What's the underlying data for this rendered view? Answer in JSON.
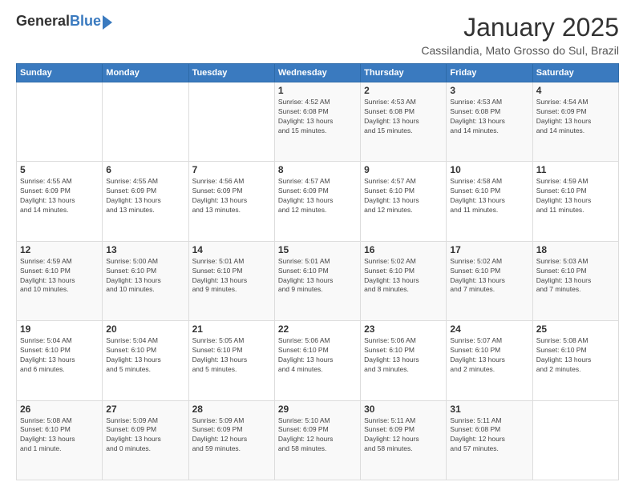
{
  "logo": {
    "general": "General",
    "blue": "Blue"
  },
  "title": "January 2025",
  "subtitle": "Cassilandia, Mato Grosso do Sul, Brazil",
  "weekdays": [
    "Sunday",
    "Monday",
    "Tuesday",
    "Wednesday",
    "Thursday",
    "Friday",
    "Saturday"
  ],
  "weeks": [
    [
      {
        "day": "",
        "info": ""
      },
      {
        "day": "",
        "info": ""
      },
      {
        "day": "",
        "info": ""
      },
      {
        "day": "1",
        "info": "Sunrise: 4:52 AM\nSunset: 6:08 PM\nDaylight: 13 hours\nand 15 minutes."
      },
      {
        "day": "2",
        "info": "Sunrise: 4:53 AM\nSunset: 6:08 PM\nDaylight: 13 hours\nand 15 minutes."
      },
      {
        "day": "3",
        "info": "Sunrise: 4:53 AM\nSunset: 6:08 PM\nDaylight: 13 hours\nand 14 minutes."
      },
      {
        "day": "4",
        "info": "Sunrise: 4:54 AM\nSunset: 6:09 PM\nDaylight: 13 hours\nand 14 minutes."
      }
    ],
    [
      {
        "day": "5",
        "info": "Sunrise: 4:55 AM\nSunset: 6:09 PM\nDaylight: 13 hours\nand 14 minutes."
      },
      {
        "day": "6",
        "info": "Sunrise: 4:55 AM\nSunset: 6:09 PM\nDaylight: 13 hours\nand 13 minutes."
      },
      {
        "day": "7",
        "info": "Sunrise: 4:56 AM\nSunset: 6:09 PM\nDaylight: 13 hours\nand 13 minutes."
      },
      {
        "day": "8",
        "info": "Sunrise: 4:57 AM\nSunset: 6:09 PM\nDaylight: 13 hours\nand 12 minutes."
      },
      {
        "day": "9",
        "info": "Sunrise: 4:57 AM\nSunset: 6:10 PM\nDaylight: 13 hours\nand 12 minutes."
      },
      {
        "day": "10",
        "info": "Sunrise: 4:58 AM\nSunset: 6:10 PM\nDaylight: 13 hours\nand 11 minutes."
      },
      {
        "day": "11",
        "info": "Sunrise: 4:59 AM\nSunset: 6:10 PM\nDaylight: 13 hours\nand 11 minutes."
      }
    ],
    [
      {
        "day": "12",
        "info": "Sunrise: 4:59 AM\nSunset: 6:10 PM\nDaylight: 13 hours\nand 10 minutes."
      },
      {
        "day": "13",
        "info": "Sunrise: 5:00 AM\nSunset: 6:10 PM\nDaylight: 13 hours\nand 10 minutes."
      },
      {
        "day": "14",
        "info": "Sunrise: 5:01 AM\nSunset: 6:10 PM\nDaylight: 13 hours\nand 9 minutes."
      },
      {
        "day": "15",
        "info": "Sunrise: 5:01 AM\nSunset: 6:10 PM\nDaylight: 13 hours\nand 9 minutes."
      },
      {
        "day": "16",
        "info": "Sunrise: 5:02 AM\nSunset: 6:10 PM\nDaylight: 13 hours\nand 8 minutes."
      },
      {
        "day": "17",
        "info": "Sunrise: 5:02 AM\nSunset: 6:10 PM\nDaylight: 13 hours\nand 7 minutes."
      },
      {
        "day": "18",
        "info": "Sunrise: 5:03 AM\nSunset: 6:10 PM\nDaylight: 13 hours\nand 7 minutes."
      }
    ],
    [
      {
        "day": "19",
        "info": "Sunrise: 5:04 AM\nSunset: 6:10 PM\nDaylight: 13 hours\nand 6 minutes."
      },
      {
        "day": "20",
        "info": "Sunrise: 5:04 AM\nSunset: 6:10 PM\nDaylight: 13 hours\nand 5 minutes."
      },
      {
        "day": "21",
        "info": "Sunrise: 5:05 AM\nSunset: 6:10 PM\nDaylight: 13 hours\nand 5 minutes."
      },
      {
        "day": "22",
        "info": "Sunrise: 5:06 AM\nSunset: 6:10 PM\nDaylight: 13 hours\nand 4 minutes."
      },
      {
        "day": "23",
        "info": "Sunrise: 5:06 AM\nSunset: 6:10 PM\nDaylight: 13 hours\nand 3 minutes."
      },
      {
        "day": "24",
        "info": "Sunrise: 5:07 AM\nSunset: 6:10 PM\nDaylight: 13 hours\nand 2 minutes."
      },
      {
        "day": "25",
        "info": "Sunrise: 5:08 AM\nSunset: 6:10 PM\nDaylight: 13 hours\nand 2 minutes."
      }
    ],
    [
      {
        "day": "26",
        "info": "Sunrise: 5:08 AM\nSunset: 6:10 PM\nDaylight: 13 hours\nand 1 minute."
      },
      {
        "day": "27",
        "info": "Sunrise: 5:09 AM\nSunset: 6:09 PM\nDaylight: 13 hours\nand 0 minutes."
      },
      {
        "day": "28",
        "info": "Sunrise: 5:09 AM\nSunset: 6:09 PM\nDaylight: 12 hours\nand 59 minutes."
      },
      {
        "day": "29",
        "info": "Sunrise: 5:10 AM\nSunset: 6:09 PM\nDaylight: 12 hours\nand 58 minutes."
      },
      {
        "day": "30",
        "info": "Sunrise: 5:11 AM\nSunset: 6:09 PM\nDaylight: 12 hours\nand 58 minutes."
      },
      {
        "day": "31",
        "info": "Sunrise: 5:11 AM\nSunset: 6:08 PM\nDaylight: 12 hours\nand 57 minutes."
      },
      {
        "day": "",
        "info": ""
      }
    ]
  ]
}
